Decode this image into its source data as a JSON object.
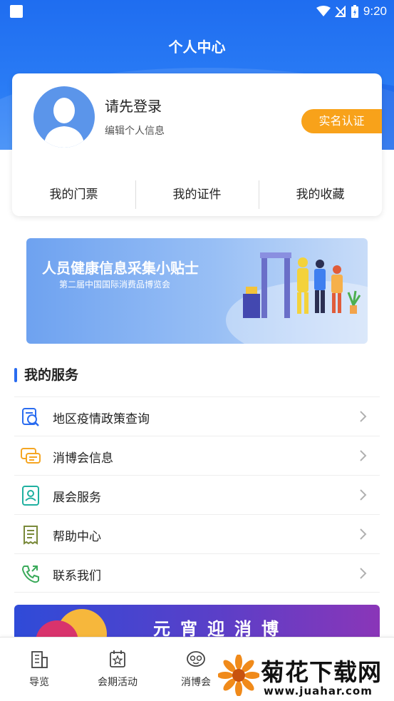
{
  "status_bar": {
    "time": "9:20"
  },
  "header": {
    "title": "个人中心"
  },
  "profile": {
    "name": "请先登录",
    "subtitle": "编辑个人信息",
    "verify_label": "实名认证",
    "tabs": [
      {
        "label": "我的门票"
      },
      {
        "label": "我的证件"
      },
      {
        "label": "我的收藏"
      }
    ]
  },
  "banner": {
    "title": "人员健康信息采集小贴士",
    "subtitle": "第二届中国国际消费品博览会"
  },
  "services": {
    "title": "我的服务",
    "items": [
      {
        "label": "地区疫情政策查询",
        "icon": "search-document-icon"
      },
      {
        "label": "消博会信息",
        "icon": "chat-bubbles-icon"
      },
      {
        "label": "展会服务",
        "icon": "service-card-icon"
      },
      {
        "label": "帮助中心",
        "icon": "receipt-icon"
      },
      {
        "label": "联系我们",
        "icon": "phone-icon"
      }
    ]
  },
  "promo": {
    "text": "元宵迎消博"
  },
  "tabbar": {
    "items": [
      {
        "label": "导览",
        "icon": "building-icon"
      },
      {
        "label": "会期活动",
        "icon": "calendar-star-icon"
      },
      {
        "label": "消博会",
        "icon": "mascot-icon"
      }
    ]
  },
  "watermark": {
    "title": "菊花下载网",
    "url": "www.juahar.com"
  },
  "colors": {
    "primary": "#2a6cf0",
    "accent": "#f8a21a"
  }
}
